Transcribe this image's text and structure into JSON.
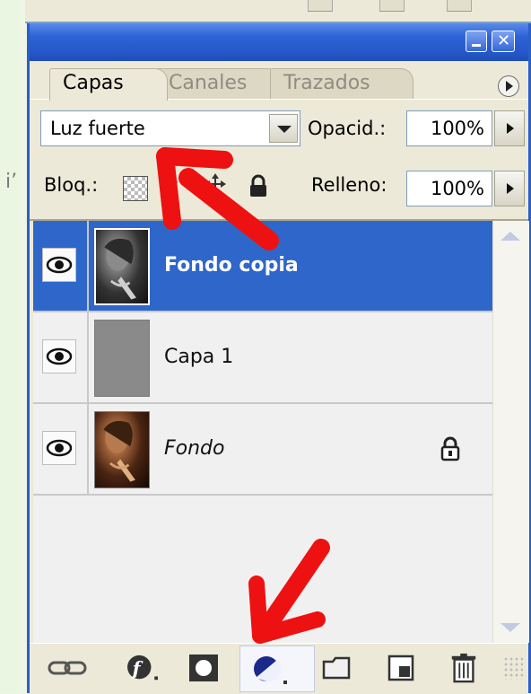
{
  "left_strip": {
    "glyph": "i’"
  },
  "tabs": [
    {
      "label": "Capas",
      "active": true
    },
    {
      "label": "Canales",
      "active": false
    },
    {
      "label": "Trazados",
      "active": false
    }
  ],
  "blend_mode": {
    "value": "Luz fuerte"
  },
  "opacity": {
    "label": "Opacid.:",
    "value": "100%"
  },
  "lock": {
    "label": "Bloq.:"
  },
  "fill": {
    "label": "Relleno:",
    "value": "100%"
  },
  "layers": [
    {
      "name": "Fondo copia",
      "selected": true,
      "visible": true,
      "locked": false,
      "italic": false
    },
    {
      "name": "Capa 1",
      "selected": false,
      "visible": true,
      "locked": false,
      "italic": false
    },
    {
      "name": "Fondo",
      "selected": false,
      "visible": true,
      "locked": true,
      "italic": true
    }
  ],
  "bottom_buttons": [
    {
      "icon": "link-layers-icon"
    },
    {
      "icon": "layer-style-icon"
    },
    {
      "icon": "layer-mask-icon"
    },
    {
      "icon": "adjustment-layer-icon",
      "highlighted": true
    },
    {
      "icon": "new-group-icon"
    },
    {
      "icon": "new-layer-icon"
    },
    {
      "icon": "trash-icon"
    }
  ],
  "colors": {
    "titlebar": "#2456c6",
    "selection": "#2e67c9",
    "annotation_arrow": "#ee1111"
  }
}
